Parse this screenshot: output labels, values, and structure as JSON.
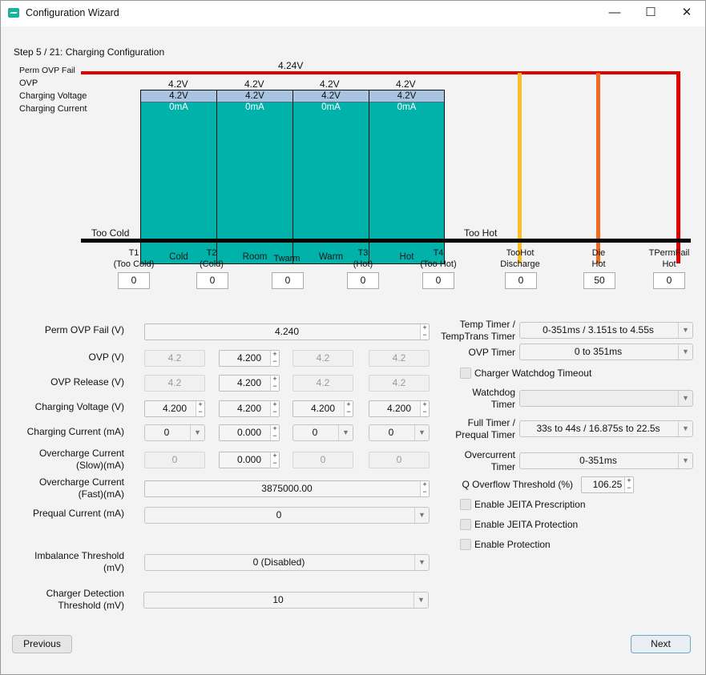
{
  "window": {
    "title": "Configuration Wizard",
    "min": "—",
    "max": "☐",
    "close": "✕"
  },
  "step": "Step 5 / 21: Charging Configuration",
  "chart": {
    "perm_ovp_label": "Perm OVP Fail",
    "perm_ovp_value": "4.24V",
    "row_labels": [
      "OVP",
      "Charging Voltage",
      "Charging Current"
    ],
    "too_cold": "Too Cold",
    "too_hot": "Too Hot",
    "zones": [
      {
        "ovp": "4.2V",
        "cv": "4.2V",
        "cc": "0mA",
        "name": "Cold"
      },
      {
        "ovp": "4.2V",
        "cv": "4.2V",
        "cc": "0mA",
        "name": "Room"
      },
      {
        "ovp": "4.2V",
        "cv": "4.2V",
        "cc": "0mA",
        "name": "Warm"
      },
      {
        "ovp": "4.2V",
        "cv": "4.2V",
        "cc": "0mA",
        "name": "Hot"
      }
    ],
    "line_colors": {
      "perm": "#e00000",
      "toohot": "#fbbf24",
      "die": "#f26a21",
      "permfail": "#e00000",
      "zone": "#00b2a9"
    },
    "thresholds": [
      {
        "line1": "T1",
        "line2": "(Too Cold)",
        "value": "0"
      },
      {
        "line1": "T2",
        "line2": "(Cold)",
        "value": "0"
      },
      {
        "line1": "Twarm",
        "line2": "",
        "value": "0"
      },
      {
        "line1": "T3",
        "line2": "(Hot)",
        "value": "0"
      },
      {
        "line1": "T4",
        "line2": "(Too Hot)",
        "value": "0"
      },
      {
        "line1": "TooHot",
        "line2": "Discharge",
        "value": "0"
      },
      {
        "line1": "Die",
        "line2": "Hot",
        "value": "50"
      },
      {
        "line1": "TPermFail",
        "line2": "Hot",
        "value": "0"
      }
    ]
  },
  "form": {
    "perm_ovp": {
      "label": "Perm OVP Fail (V)",
      "value": "4.240"
    },
    "ovp": {
      "label": "OVP (V)",
      "values": [
        "4.2",
        "4.200",
        "4.2",
        "4.2"
      ]
    },
    "ovp_release": {
      "label": "OVP Release (V)",
      "values": [
        "4.2",
        "4.200",
        "4.2",
        "4.2"
      ]
    },
    "charging_voltage": {
      "label": "Charging Voltage (V)",
      "values": [
        "4.200",
        "4.200",
        "4.200",
        "4.200"
      ]
    },
    "charging_current": {
      "label": "Charging Current (mA)",
      "values": [
        "0",
        "0.000",
        "0",
        "0"
      ]
    },
    "overcharge_slow": {
      "label1": "Overcharge Current",
      "label2": "(Slow)(mA)",
      "values": [
        "0",
        "0.000",
        "0",
        "0"
      ]
    },
    "overcharge_fast": {
      "label1": "Overcharge Current",
      "label2": "(Fast)(mA)",
      "value": "3875000.00"
    },
    "prequal": {
      "label": "Prequal Current (mA)",
      "value": "0"
    },
    "imbalance": {
      "label1": "Imbalance Threshold",
      "label2": "(mV)",
      "value": "0 (Disabled)"
    },
    "charger_detect": {
      "label1": "Charger Detection",
      "label2": "Threshold (mV)",
      "value": "10"
    }
  },
  "right": {
    "temp_timer": {
      "label1": "Temp Timer /",
      "label2": "TempTrans Timer",
      "value": "0-351ms / 3.151s to 4.55s"
    },
    "ovp_timer": {
      "label": "OVP Timer",
      "value": "0 to 351ms"
    },
    "watchdog_chk": "Charger Watchdog Timeout",
    "watchdog_timer": {
      "label1": "Watchdog",
      "label2": "Timer",
      "value": ""
    },
    "full_timer": {
      "label1": "Full Timer /",
      "label2": "Prequal Timer",
      "value": "33s to 44s / 16.875s to 22.5s"
    },
    "overcurrent": {
      "label1": "Overcurrent",
      "label2": "Timer",
      "value": "0-351ms"
    },
    "q_overflow": {
      "label": "Q Overflow Threshold (%)",
      "value": "106.25"
    },
    "jeita_presc": "Enable JEITA Prescription",
    "jeita_prot": "Enable JEITA Protection",
    "enable_prot": "Enable Protection"
  },
  "buttons": {
    "previous": "Previous",
    "next": "Next"
  }
}
